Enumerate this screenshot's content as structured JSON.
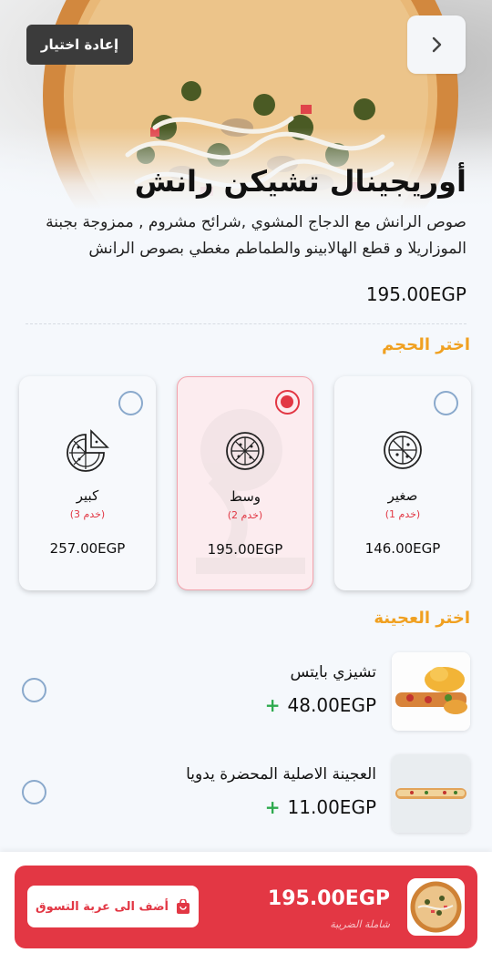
{
  "header": {
    "reset_label": "إعادة اختيار",
    "back_icon": "chevron-right-icon"
  },
  "product": {
    "title": "أوريجينال تشيكن رانش",
    "description": "صوص الرانش مع الدجاج المشوي ,شرائح مشروم , ممزوجة بجبنة الموزاريلا و قطع الهالابينو والطماطم مغطي بصوص الرانش",
    "price": "195.00EGP"
  },
  "size_section": {
    "title": "اختر الحجم",
    "options": [
      {
        "name": "صغير",
        "serves": "(خدم 1)",
        "price": "146.00EGP",
        "selected": false
      },
      {
        "name": "وسط",
        "serves": "(خدم 2)",
        "price": "195.00EGP",
        "selected": true
      },
      {
        "name": "كبير",
        "serves": "(خدم 3)",
        "price": "257.00EGP",
        "selected": false
      }
    ]
  },
  "dough_section": {
    "title": "اختر العجينة",
    "options": [
      {
        "name": "تشيزي بايتس",
        "plus": "+",
        "price": "48.00EGP",
        "selected": false
      },
      {
        "name": "العجينة الاصلية المحضرة يدويا",
        "plus": "+",
        "price": "11.00EGP",
        "selected": false
      }
    ]
  },
  "cart": {
    "add_label": "أضف الى عربة التسوق",
    "add_icon": "shopping-bag-icon",
    "total": "195.00EGP",
    "tax_note": "شاملة الضريبة"
  },
  "colors": {
    "accent_red": "#e33744",
    "section_orange": "#f0a020",
    "plus_green": "#2eaa4e"
  }
}
